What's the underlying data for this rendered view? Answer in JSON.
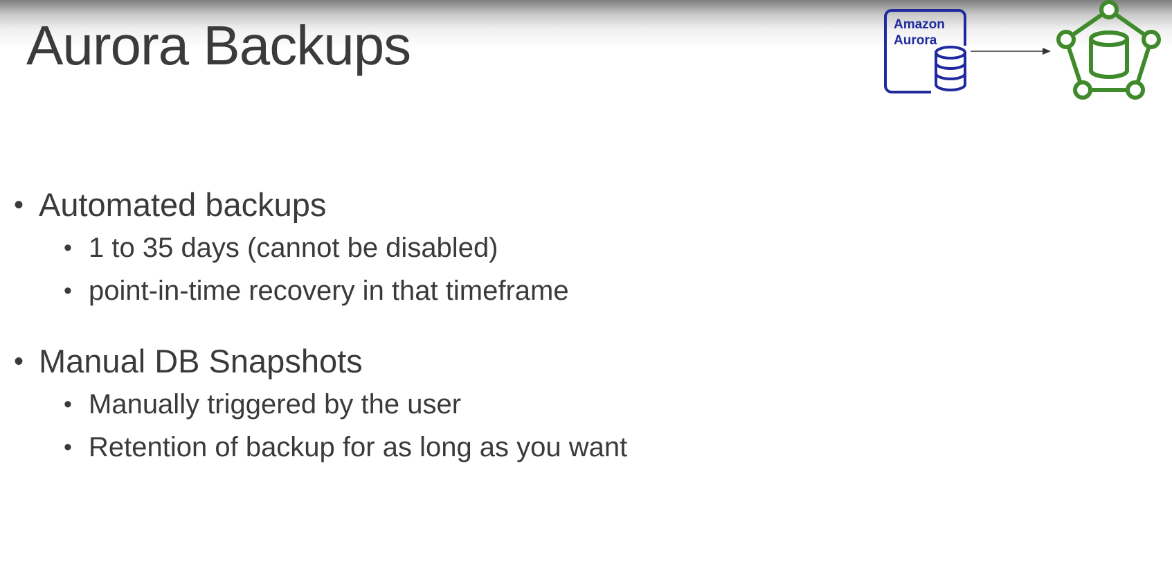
{
  "slide": {
    "title": "Aurora Backups",
    "groups": [
      {
        "heading": "Automated backups",
        "items": [
          "1 to 35 days (cannot be disabled)",
          "point-in-time recovery in that timeframe"
        ]
      },
      {
        "heading": "Manual DB Snapshots",
        "items": [
          "Manually triggered by the user",
          "Retention of backup for as long as you want"
        ]
      }
    ]
  },
  "diagram": {
    "aurora_icon": "amazon-aurora-database-icon",
    "aurora_label_line1": "Amazon",
    "aurora_label_line2": "Aurora",
    "arrow": "right-arrow-icon",
    "snapshot_icon": "database-snapshot-network-icon",
    "colors": {
      "aurora": "#1f2a9e",
      "snapshot": "#3f8a2a",
      "arrow": "#333333"
    }
  }
}
